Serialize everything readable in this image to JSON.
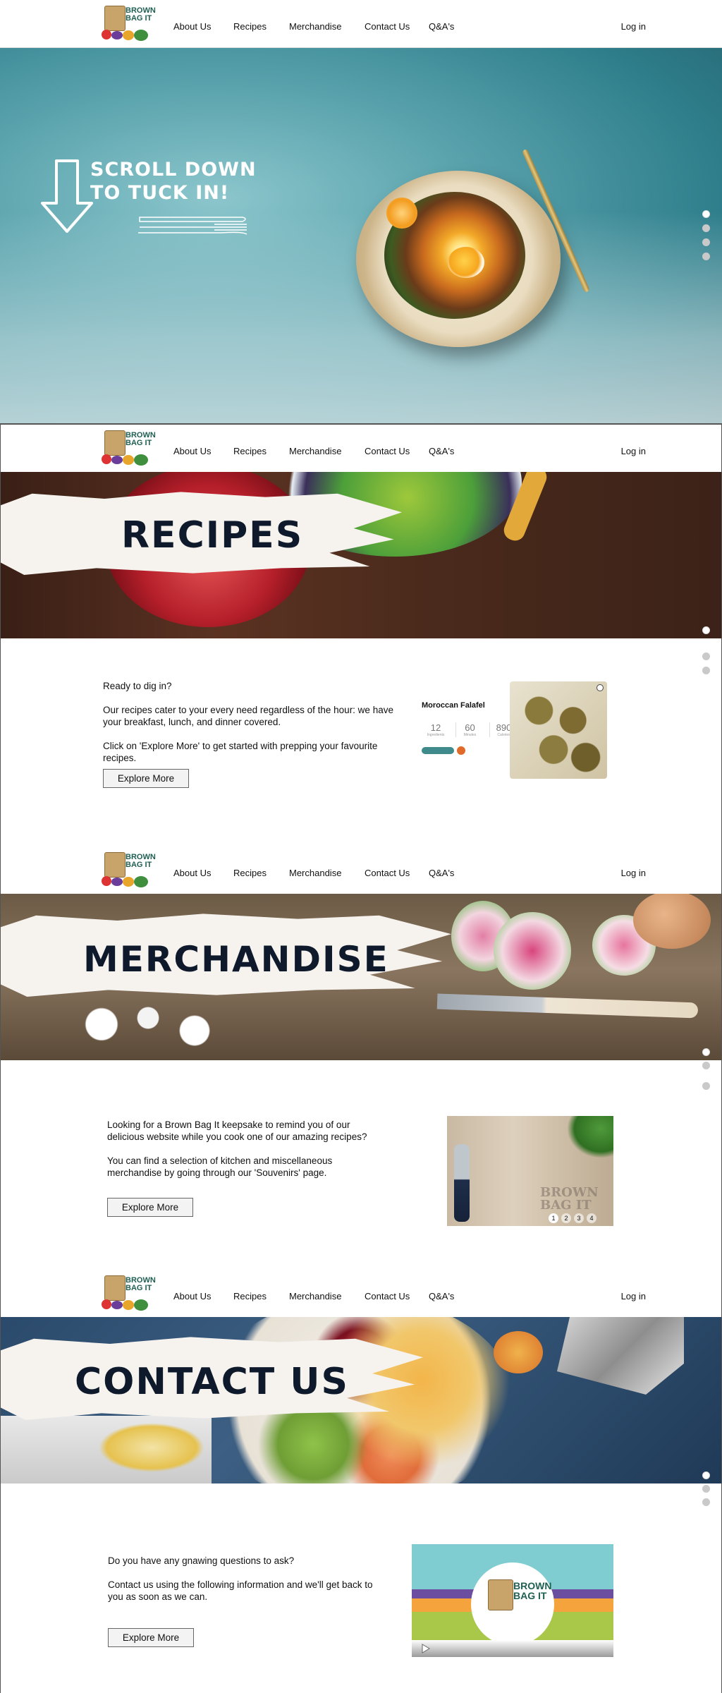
{
  "nav": {
    "logo_text_1": "BROWN",
    "logo_text_2": "BAG IT",
    "links": [
      "About Us",
      "Recipes",
      "Merchandise",
      "Contact Us",
      "Q&A's"
    ],
    "login": "Log in"
  },
  "hero": {
    "line1": "SCROLL DOWN",
    "line2": "TO TUCK IN!"
  },
  "recipes": {
    "banner_title": "RECIPES",
    "intro": "Ready to dig in?",
    "para1": "Our recipes cater to your every need regardless of the hour: we have your breakfast, lunch, and dinner covered.",
    "para2": "Click on 'Explore More' to get started with prepping your favourite recipes.",
    "button": "Explore More",
    "card": {
      "title": "Moroccan Falafel",
      "stats": [
        {
          "value": "12",
          "label": "Ingredients"
        },
        {
          "value": "60",
          "label": "Minutes"
        },
        {
          "value": "890",
          "label": "Calories"
        }
      ]
    }
  },
  "merch": {
    "banner_title": "MERCHANDISE",
    "para1": "Looking for a Brown Bag It keepsake to remind you of our delicious website while you cook one of our amazing recipes?",
    "para2": "You can find a selection of kitchen and miscellaneous merchandise by going through our 'Souvenirs' page.",
    "button": "Explore More",
    "gallery_pages": [
      "1",
      "2",
      "3",
      "4"
    ],
    "watermark": "BROWN BAG IT"
  },
  "contact": {
    "banner_title": "CONTACT US",
    "para1": "Do you have any gnawing questions to ask?",
    "para2": "Contact us using the following information and we'll get back to you as soon as we can.",
    "button": "Explore More",
    "video_logo": "BROWN BAG IT"
  }
}
